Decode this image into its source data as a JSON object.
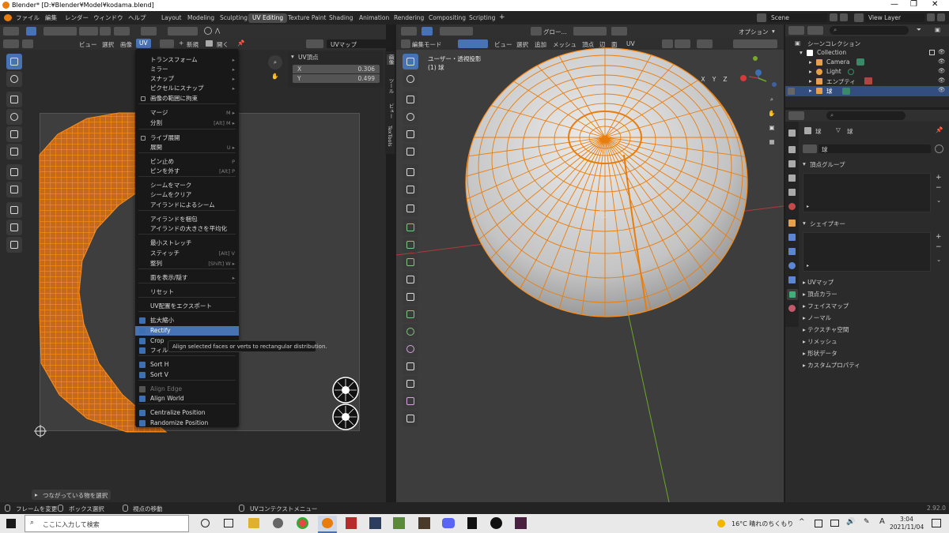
{
  "window": {
    "title": "Blender* [D:¥Blender¥Model¥kodama.blend]"
  },
  "topmenu": [
    "ファイル",
    "編集",
    "レンダー",
    "ウィンドウ",
    "ヘルプ"
  ],
  "workspaces": [
    "Layout",
    "Modeling",
    "Sculpting",
    "UV Editing",
    "Texture Paint",
    "Shading",
    "Animation",
    "Rendering",
    "Compositing",
    "Scripting"
  ],
  "scene_label": "Scene",
  "view_layer_label": "View Layer",
  "uv_header": {
    "menus": [
      "ビュー",
      "選択",
      "画像",
      "UV"
    ],
    "new_label": "新規",
    "open_label": "開く",
    "uvmap": "UVマップ"
  },
  "uv_vertex": {
    "title": "UV頂点",
    "x_label": "X",
    "x_value": "0.306",
    "y_label": "Y",
    "y_value": "0.499"
  },
  "uv_sidetabs": [
    "画像",
    "ツール",
    "ビュー",
    "TexTools"
  ],
  "menu": {
    "items": [
      {
        "label": "トランスフォーム",
        "shortcut": "",
        "sub": true
      },
      {
        "label": "ミラー",
        "shortcut": "",
        "sub": true
      },
      {
        "label": "スナップ",
        "shortcut": "",
        "sub": true
      },
      {
        "label": "ピクセルにスナップ",
        "shortcut": "",
        "sub": true
      },
      {
        "label": "画像の範囲に拘束",
        "shortcut": "",
        "check": true
      },
      {
        "label": "マージ",
        "shortcut": "M",
        "sub": true
      },
      {
        "label": "分割",
        "shortcut": "[Alt] M",
        "sub": true
      },
      {
        "label": "ライブ展開",
        "shortcut": "",
        "check": true
      },
      {
        "label": "展開",
        "shortcut": "U",
        "sub": true
      },
      {
        "label": "ピン止め",
        "shortcut": "P"
      },
      {
        "label": "ピンを外す",
        "shortcut": "[Alt] P"
      },
      {
        "label": "シームをマーク",
        "shortcut": ""
      },
      {
        "label": "シームをクリア",
        "shortcut": ""
      },
      {
        "label": "アイランドによるシーム",
        "shortcut": ""
      },
      {
        "label": "アイランドを梱包",
        "shortcut": ""
      },
      {
        "label": "アイランドの大きさを平均化",
        "shortcut": ""
      },
      {
        "label": "最小ストレッチ",
        "shortcut": ""
      },
      {
        "label": "スティッチ",
        "shortcut": "[Alt] V"
      },
      {
        "label": "整列",
        "shortcut": "[Shift] W",
        "sub": true
      },
      {
        "label": "面を表示/隠す",
        "shortcut": "",
        "sub": true
      },
      {
        "label": "リセット",
        "shortcut": ""
      },
      {
        "label": "UV配置をエクスポート",
        "shortcut": ""
      },
      {
        "label": "拡大縮小",
        "shortcut": "",
        "icon": true
      },
      {
        "label": "Rectify",
        "shortcut": "",
        "icon": true,
        "highlight": true
      },
      {
        "label": "Crop",
        "shortcut": "",
        "icon": true
      },
      {
        "label": "フィル",
        "shortcut": "",
        "icon": true
      },
      {
        "label": "Sort H",
        "shortcut": "",
        "icon": true
      },
      {
        "label": "Sort V",
        "shortcut": "",
        "icon": true
      },
      {
        "label": "Align Edge",
        "shortcut": "",
        "icon": true,
        "disabled": true
      },
      {
        "label": "Align World",
        "shortcut": "",
        "icon": true
      },
      {
        "label": "Centralize Position",
        "shortcut": "",
        "icon": true
      },
      {
        "label": "Randomize Position",
        "shortcut": "",
        "icon": true
      }
    ]
  },
  "tooltip": "Align selected faces or verts to rectangular distribution.",
  "uv_status": "つながっている物を選択",
  "viewport": {
    "mode": "編集モード",
    "menus": [
      "ビュー",
      "選択",
      "追加",
      "メッシュ",
      "頂点",
      "辺",
      "面",
      "UV"
    ],
    "transform": "グロー...",
    "options": "オプション",
    "view_name": "ユーザー・透視投影",
    "object_name": "(1) 球",
    "axes": [
      "X",
      "Y",
      "Z"
    ]
  },
  "outliner": {
    "root": "シーンコレクション",
    "items": [
      "Collection",
      "Camera",
      "Light",
      "エンプティ",
      "球"
    ]
  },
  "properties": {
    "object": "球",
    "mesh": "球",
    "data_name": "球",
    "sections_open": [
      "頂点グループ",
      "シェイプキー"
    ],
    "sections": [
      "UVマップ",
      "頂点カラー",
      "フェイスマップ",
      "ノーマル",
      "テクスチャ空間",
      "リメッシュ",
      "形状データ",
      "カスタムプロパティ"
    ]
  },
  "statusbar": {
    "items": [
      "フレームを変更",
      "ボックス選択",
      "視点の移動",
      "UVコンテクストメニュー"
    ],
    "version": "2.92.0"
  },
  "taskbar": {
    "search_placeholder": "ここに入力して検索",
    "weather": "16°C 晴れのちくもり",
    "ime": "A",
    "time": "3:04",
    "date": "2021/11/04"
  },
  "colors": {
    "accent": "#4772b3",
    "mesh_orange": "#e87d0d",
    "bg": "#1d1d1d"
  }
}
